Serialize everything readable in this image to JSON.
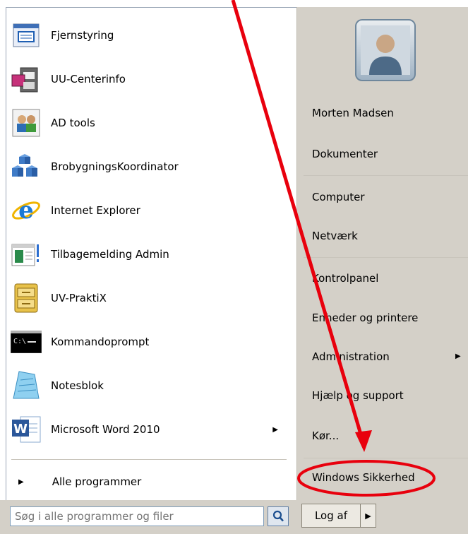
{
  "pinned": [
    {
      "label": "Fjernstyring",
      "icon": "remote-desktop-icon"
    },
    {
      "label": "UU-Centerinfo",
      "icon": "uu-centerinfo-icon"
    },
    {
      "label": "AD tools",
      "icon": "ad-tools-icon"
    },
    {
      "label": "BrobygningsKoordinator",
      "icon": "brobygning-icon"
    },
    {
      "label": "Internet Explorer",
      "icon": "internet-explorer-icon"
    },
    {
      "label": "Tilbagemelding Admin",
      "icon": "tilbagemelding-icon"
    },
    {
      "label": "UV-PraktiX",
      "icon": "uv-praktix-icon"
    },
    {
      "label": "Kommandoprompt",
      "icon": "command-prompt-icon"
    },
    {
      "label": "Notesblok",
      "icon": "notepad-icon"
    },
    {
      "label": "Microsoft Word 2010",
      "icon": "word-icon",
      "submenu": true
    }
  ],
  "all_programs": "Alle programmer",
  "right": {
    "user": "Morten Madsen",
    "documents": "Dokumenter",
    "computer": "Computer",
    "network": "Netværk",
    "control_panel": "Kontrolpanel",
    "devices": "Enheder og printere",
    "admin": "Administration",
    "help": "Hjælp og support",
    "run": "Kør...",
    "security": "Windows Sikkerhed"
  },
  "search": {
    "placeholder": "Søg i alle programmer og filer"
  },
  "logoff": "Log af",
  "colors": {
    "annotation": "#e8000d",
    "panel": "#d4d0c8"
  }
}
